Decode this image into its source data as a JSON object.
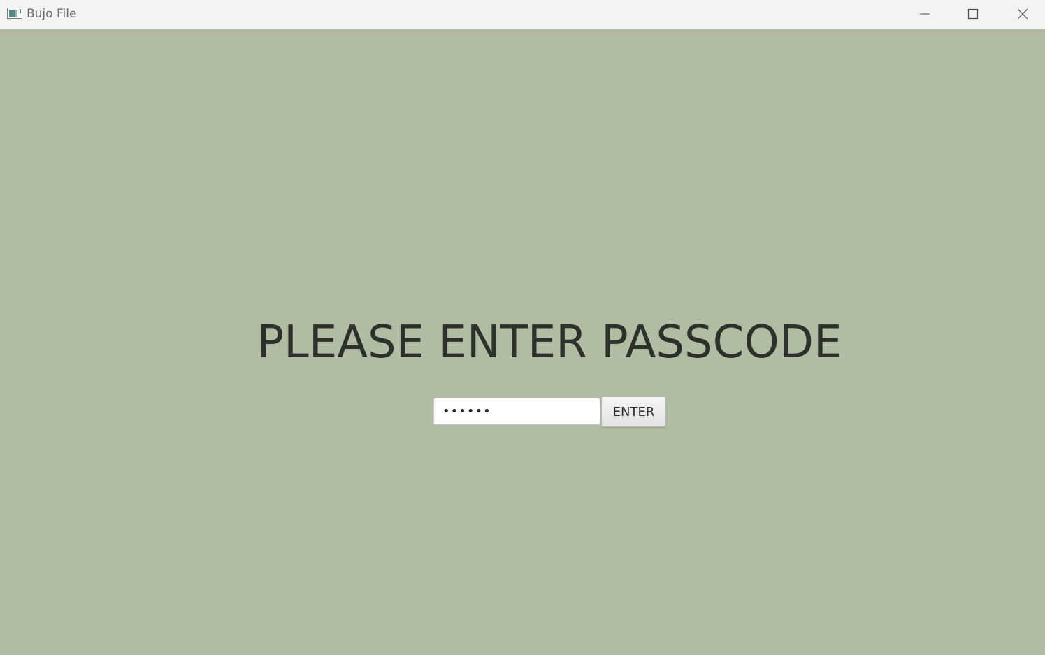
{
  "window": {
    "title": "Bujo File",
    "icons": {
      "app": "app-window-icon",
      "minimize": "minimize-icon",
      "maximize": "maximize-icon",
      "close": "close-icon"
    }
  },
  "passcode_screen": {
    "prompt": "PLEASE ENTER PASSCODE",
    "input_value": "••••••",
    "enter_label": "ENTER"
  },
  "colors": {
    "background": "#b1bda2",
    "titlebar": "#f3f3f3",
    "text": "#2e302b"
  }
}
